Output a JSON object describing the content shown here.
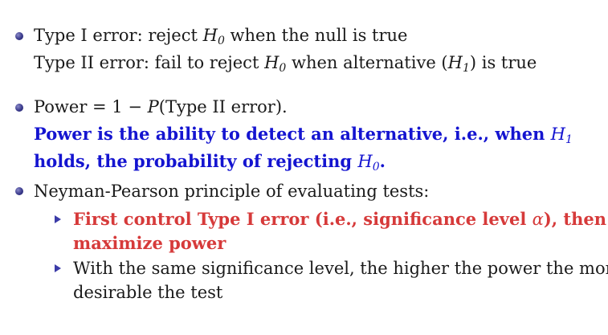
{
  "bullets": [
    {
      "line1": {
        "a": "Type I error: reject ",
        "h": "H",
        "hsub": "0",
        "b": " when the null is true"
      },
      "line2": {
        "a": "Type II error: fail to reject ",
        "h": "H",
        "hsub": "0",
        "b": " when alternative (",
        "h2": "H",
        "h2sub": "1",
        "c": ") is true"
      }
    },
    {
      "line1": {
        "a": "Power = 1 − ",
        "p": "P",
        "b": "(Type II error)."
      },
      "line2": {
        "a": "Power is the ability to detect an alternative, i.e., when ",
        "h": "H",
        "hsub": "1"
      },
      "line3": {
        "a": "holds, the probability of rejecting ",
        "h": "H",
        "hsub": "0",
        "b": "."
      }
    },
    {
      "line1": "Neyman-Pearson principle of evaluating tests:",
      "sub": [
        {
          "line1": {
            "a": "First control Type I error (i.e., significance level ",
            "alpha": "α",
            "b": "), then"
          },
          "line2": "maximize power"
        },
        {
          "line1": "With the same significance level, the higher the power the more",
          "line2": "desirable the test"
        }
      ]
    }
  ],
  "colors": {
    "emphasis_blue": "#1414d0",
    "emphasis_red": "#d63a3a",
    "bullet": "#3a3a8c"
  }
}
